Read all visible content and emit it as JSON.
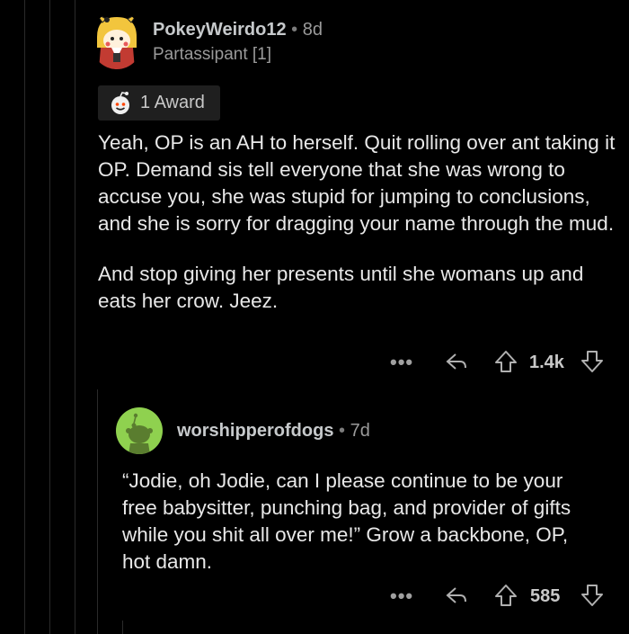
{
  "comment": {
    "username": "PokeyWeirdo12",
    "separator": "•",
    "age": "8d",
    "flair": "Partassipant [1]",
    "award": {
      "icon": "award-face-icon",
      "label": "1 Award"
    },
    "paragraphs": [
      "Yeah, OP is an AH to herself. Quit rolling over ant taking it OP. Demand sis tell everyone that she was wrong to accuse you, she was stupid for jumping to conclusions, and she is sorry for dragging your name through the mud.",
      "And stop giving her presents until she womans up and eats her crow. Jeez."
    ],
    "actions": {
      "more": "•••",
      "score": "1.4k"
    }
  },
  "reply": {
    "username": "worshipperofdogs",
    "separator": "•",
    "age": "7d",
    "paragraphs": [
      "“Jodie, oh Jodie, can I please continue to be your free babysitter, punching bag, and provider of gifts while you shit all over me!” Grow a backbone, OP, hot damn."
    ],
    "actions": {
      "more": "•••",
      "score": "585"
    }
  },
  "colors": {
    "background": "#000000",
    "text": "#e8e8e8",
    "muted": "#9a9a9a",
    "snoo_avatar_bg": "#8fd14f",
    "award_chip_bg": "#1f1f1f"
  }
}
